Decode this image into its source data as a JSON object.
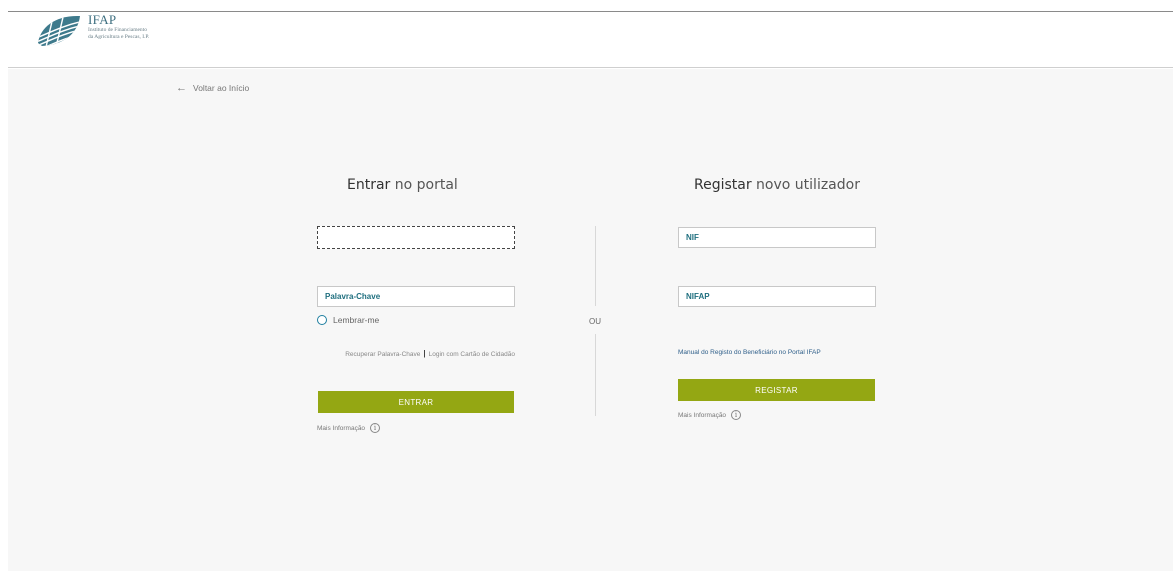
{
  "header": {
    "org_name": "IFAP",
    "org_sub_line1": "Instituto de Financiamento",
    "org_sub_line2": "da Agricultura e Pescas, I.P.",
    "brand_color": "#3e6f80"
  },
  "nav": {
    "back_arrow_icon": "arrow-left-icon",
    "back_label": "Voltar ao Início"
  },
  "login": {
    "title_bold": "Entrar",
    "title_rest": " no portal",
    "username_value": "",
    "password_placeholder": "Palavra-Chave",
    "remember_label": "Lembrar-me",
    "recover_link": "Recuperar Palavra-Chave",
    "separator": "|",
    "citizen_card_link": "Login com Cartão de Cidadão",
    "submit_label": "ENTRAR",
    "more_info_label": "Mais Informação",
    "info_icon": "i"
  },
  "divider": {
    "or_label": "OU"
  },
  "register": {
    "title_bold": "Registar",
    "title_rest": " novo utilizador",
    "nif_placeholder": "NIF",
    "nifap_placeholder": "NIFAP",
    "manual_link": "Manual do Registo do Beneficiário no Portal IFAP",
    "submit_label": "REGISTAR",
    "more_info_label": "Mais Informação",
    "info_icon": "i"
  },
  "colors": {
    "accent_button": "#94a713",
    "input_text": "#1f6f7f",
    "background": "#f7f7f7"
  }
}
